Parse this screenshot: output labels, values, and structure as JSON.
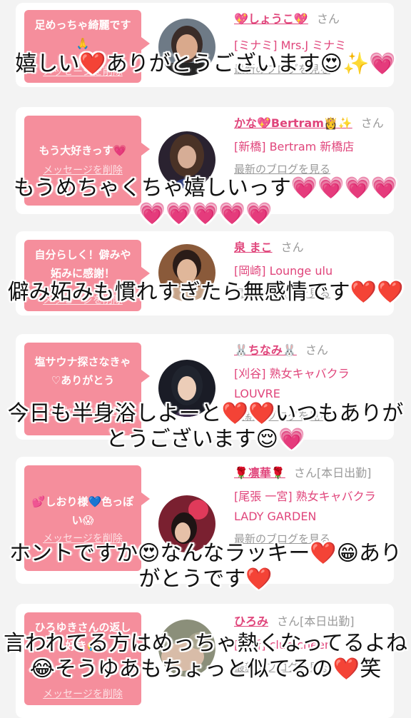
{
  "delete_label": "メッセージを削除",
  "blog_label": "最新のブログを見る",
  "san_label": "さん",
  "accent_color": "#e0457b",
  "bubble_color": "#f58e9c",
  "cards": [
    {
      "message": "足めっちゃ綺麗です🙏",
      "name": "💖しょうこ💖",
      "san": "さん",
      "shop": "[ミナミ] Mrs.J ミナミ",
      "reply": "嬉しい❤️ありがとうございます😍✨💗"
    },
    {
      "message": "もう大好きっす💗",
      "name": "かな💖Bertram👸✨",
      "san": "さん",
      "shop": "[新橋] Bertram 新橋店",
      "reply": "もうめちゃくちゃ嬉しいっす💗💗💗💗💗💗💗💗💗"
    },
    {
      "message": "自分らしく！僻みや妬みに感謝！",
      "name": "泉 まこ",
      "san": "さん",
      "shop": "[岡崎] Lounge ulu",
      "reply": "僻み妬みも慣れすぎたら無感情です❤️❤️"
    },
    {
      "message": "塩サウナ探さなきゃ♡ありがとう",
      "name": "🐰ちなみ🐰",
      "san": "さん",
      "shop": "[刈谷] 熟女キャバクラ LOUVRE",
      "reply": "今日も半身浴しよーと❤️❤️いつもありがとうございます😌💗"
    },
    {
      "message": "💕しおり様💙色っぽい😱",
      "name": "🌹凛華🌹",
      "san": "さん[本日出勤]",
      "shop": "[尾張 一宮] 熟女キャバクラ LADY GARDEN",
      "reply": "ホントですか😍なんなラッキー❤️😁ありがとうです❤️"
    },
    {
      "message": "ひろゆきさんの返し好き🤣",
      "name": "ひろみ",
      "san": "さん[本日出勤]",
      "shop": "[西新] club cheer",
      "reply": "言われてる方はめっちゃ熱くなってるよね😂そうゆあもちょっと似てるの❤️笑"
    }
  ]
}
